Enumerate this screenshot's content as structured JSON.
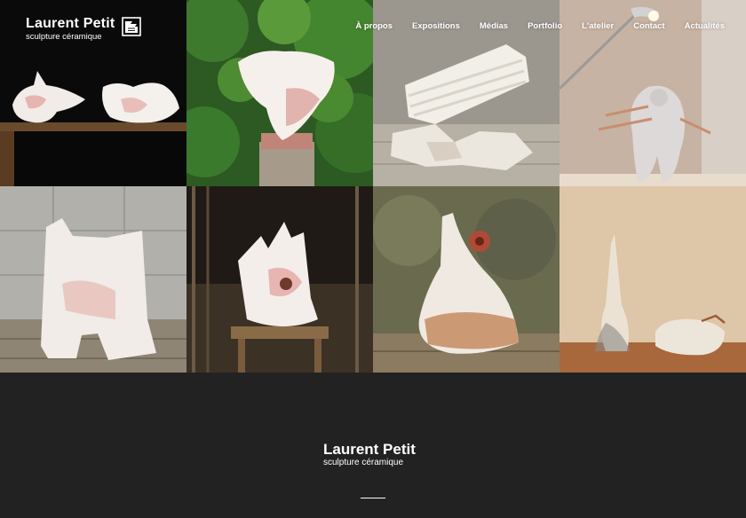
{
  "brand": {
    "name": "Laurent Petit",
    "tagline": "sculpture céramique",
    "logo_icon": "ceramic-logo-icon"
  },
  "nav": [
    {
      "label": "À propos"
    },
    {
      "label": "Expositions"
    },
    {
      "label": "Médias"
    },
    {
      "label": "Portfolio"
    },
    {
      "label": "L'atelier"
    },
    {
      "label": "Contact"
    },
    {
      "label": "Actualités"
    }
  ],
  "gallery": {
    "tiles": [
      "sculptures-on-black-shelf",
      "white-sculpture-on-pedestal-garden",
      "folded-sculpture-on-wooden-floor",
      "sculpture-under-desk-lamp",
      "architectural-white-sculpture",
      "sculpture-on-wooden-stool",
      "cone-vessel-sculpture",
      "sculptures-on-wooden-table"
    ]
  },
  "footer": {
    "name": "Laurent Petit",
    "tagline": "sculpture céramique"
  },
  "colors": {
    "background": "#222222",
    "text": "#ffffff"
  }
}
